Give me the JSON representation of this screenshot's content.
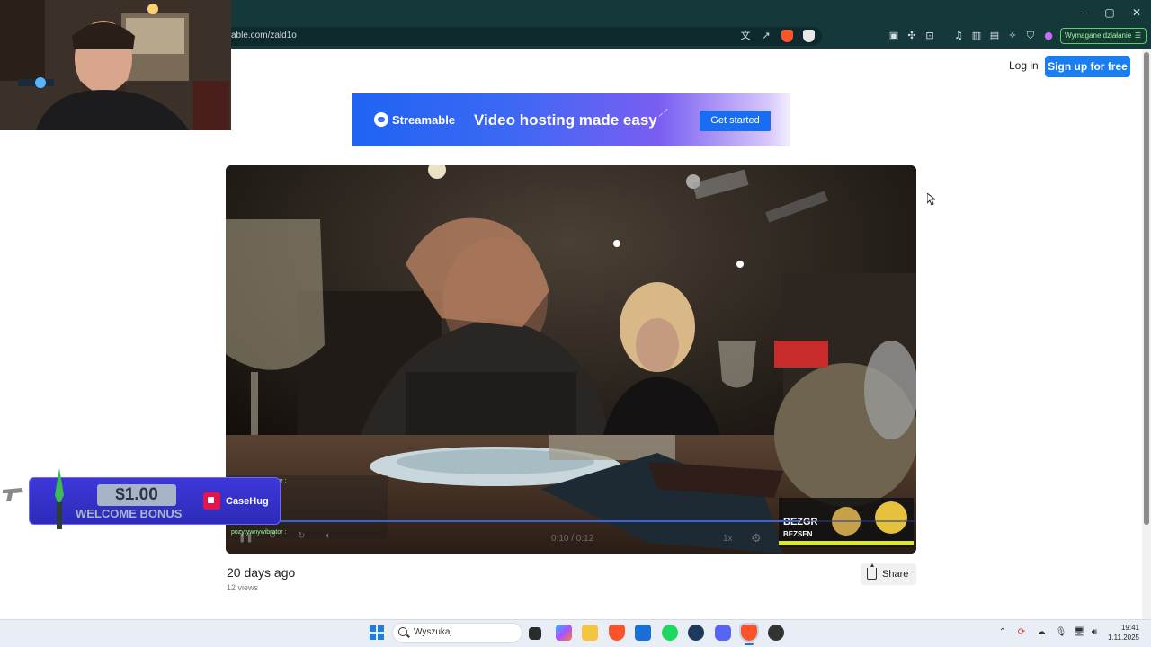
{
  "browser": {
    "url_fragment": "able.com/zald1o",
    "required_action_label": "Wymagane działanie",
    "window_controls": {
      "minimize": "–",
      "maximize": "▢",
      "close": "✕"
    }
  },
  "header": {
    "login_label": "Log in",
    "signup_label": "Sign up for free"
  },
  "banner": {
    "brand": "Streamable",
    "tagline": "Video hosting made easy",
    "cta_label": "Get started"
  },
  "video": {
    "time_display": "0:10 / 0:12",
    "speed": "1x",
    "progress": 0.83,
    "chat_user": "pozytywnywibrator :"
  },
  "meta": {
    "posted": "20 days ago",
    "views": "12 views",
    "share_label": "Share"
  },
  "casehug_overlay": {
    "amount": "$1.00",
    "bonus_text": "WELCOME BONUS",
    "brand": "CaseHug"
  },
  "taskbar": {
    "search_placeholder": "Wyszukaj",
    "time": "19:41",
    "date": "1.11.2025"
  },
  "colors": {
    "browser_chrome": "#15383b",
    "accent_blue": "#1a7df0",
    "casehug_blue": "#3d37d9",
    "taskbar": "#e9eef6"
  }
}
